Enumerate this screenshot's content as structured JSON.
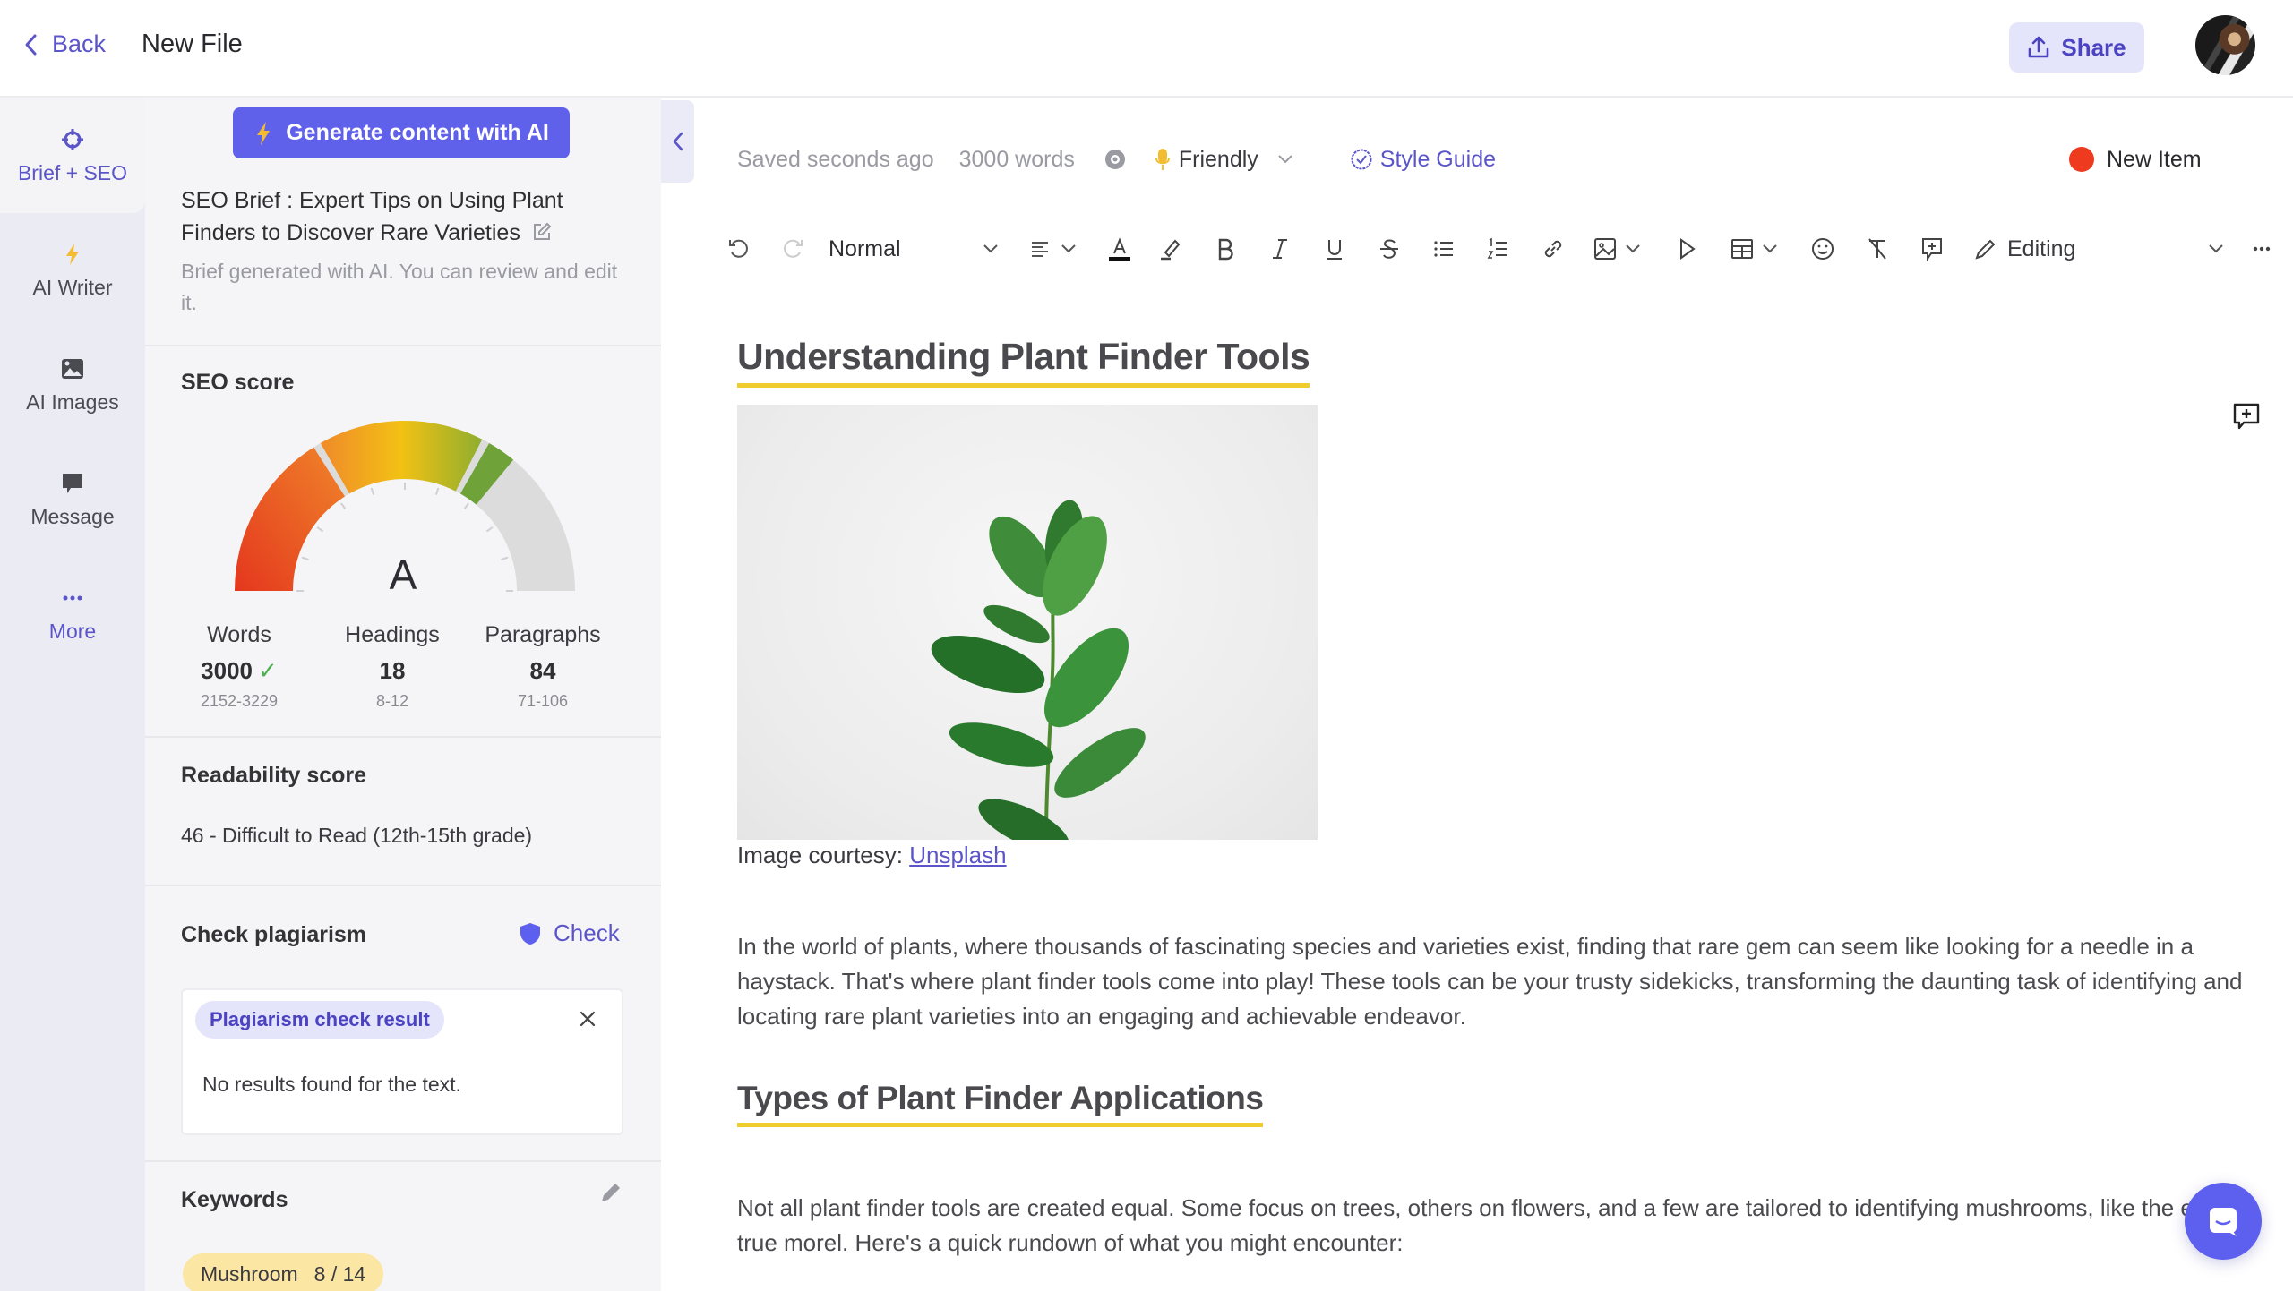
{
  "header": {
    "back_label": "Back",
    "file_title": "New File",
    "share_label": "Share"
  },
  "rail": {
    "items": [
      {
        "label": "Brief + SEO",
        "icon": "crosshair-icon",
        "active": true
      },
      {
        "label": "AI Writer",
        "icon": "lightning-icon"
      },
      {
        "label": "AI Images",
        "icon": "image-icon"
      },
      {
        "label": "Message",
        "icon": "message-icon"
      },
      {
        "label": "More",
        "icon": "ellipsis-icon"
      }
    ]
  },
  "panel": {
    "generate_label": "Generate content with AI",
    "brief_title": "SEO Brief : Expert Tips on Using Plant Finders to Discover Rare Varieties",
    "brief_note": "Brief generated with AI. You can review and edit it.",
    "seo": {
      "title": "SEO score",
      "grade": "A",
      "gauge_fill_fraction": 0.72,
      "stats": [
        {
          "label": "Words",
          "value": "3000",
          "range": "2152-3229",
          "ok": true
        },
        {
          "label": "Headings",
          "value": "18",
          "range": "8-12"
        },
        {
          "label": "Paragraphs",
          "value": "84",
          "range": "71-106"
        }
      ],
      "check_mark": "✓"
    },
    "readability": {
      "title": "Readability score",
      "value": "46 - Difficult to Read (12th-15th grade)"
    },
    "plagiarism": {
      "title": "Check plagiarism",
      "check_label": "Check",
      "result_chip": "Plagiarism check result",
      "result_text": "No results found for the text."
    },
    "keywords": {
      "title": "Keywords",
      "items": [
        {
          "word": "Mushroom",
          "count": "8 / 14"
        }
      ]
    }
  },
  "editor": {
    "saved_status": "Saved seconds ago",
    "word_count": "3000 words",
    "tone": "Friendly",
    "style_guide": "Style Guide",
    "new_item": "New Item",
    "toolbar": {
      "text_style": "Normal",
      "mode": "Editing"
    },
    "doc": {
      "heading1": "Understanding Plant Finder Tools",
      "caption_prefix": "Image courtesy: ",
      "caption_link": "Unsplash",
      "paragraph1": "In the world of plants, where thousands of fascinating species and varieties exist, finding that rare gem can seem like looking for a needle in a haystack. That's where plant finder tools come into play! These tools can be your trusty sidekicks, transforming the daunting task of identifying and locating rare plant varieties into an engaging and achievable endeavor.",
      "heading2": "Types of Plant Finder Applications",
      "paragraph2": "Not all plant finder tools are created equal. Some focus on trees, others on flowers, and a few are tailored to identifying mushrooms, like the elusive true morel. Here's a quick rundown of what you might encounter:"
    }
  },
  "colors": {
    "accent": "#5b55c9",
    "primary_button": "#6061ea",
    "heading_underline": "#f0cd2e",
    "keyword_chip": "#fbe6a4",
    "new_item_dot": "#ee3a1e"
  }
}
